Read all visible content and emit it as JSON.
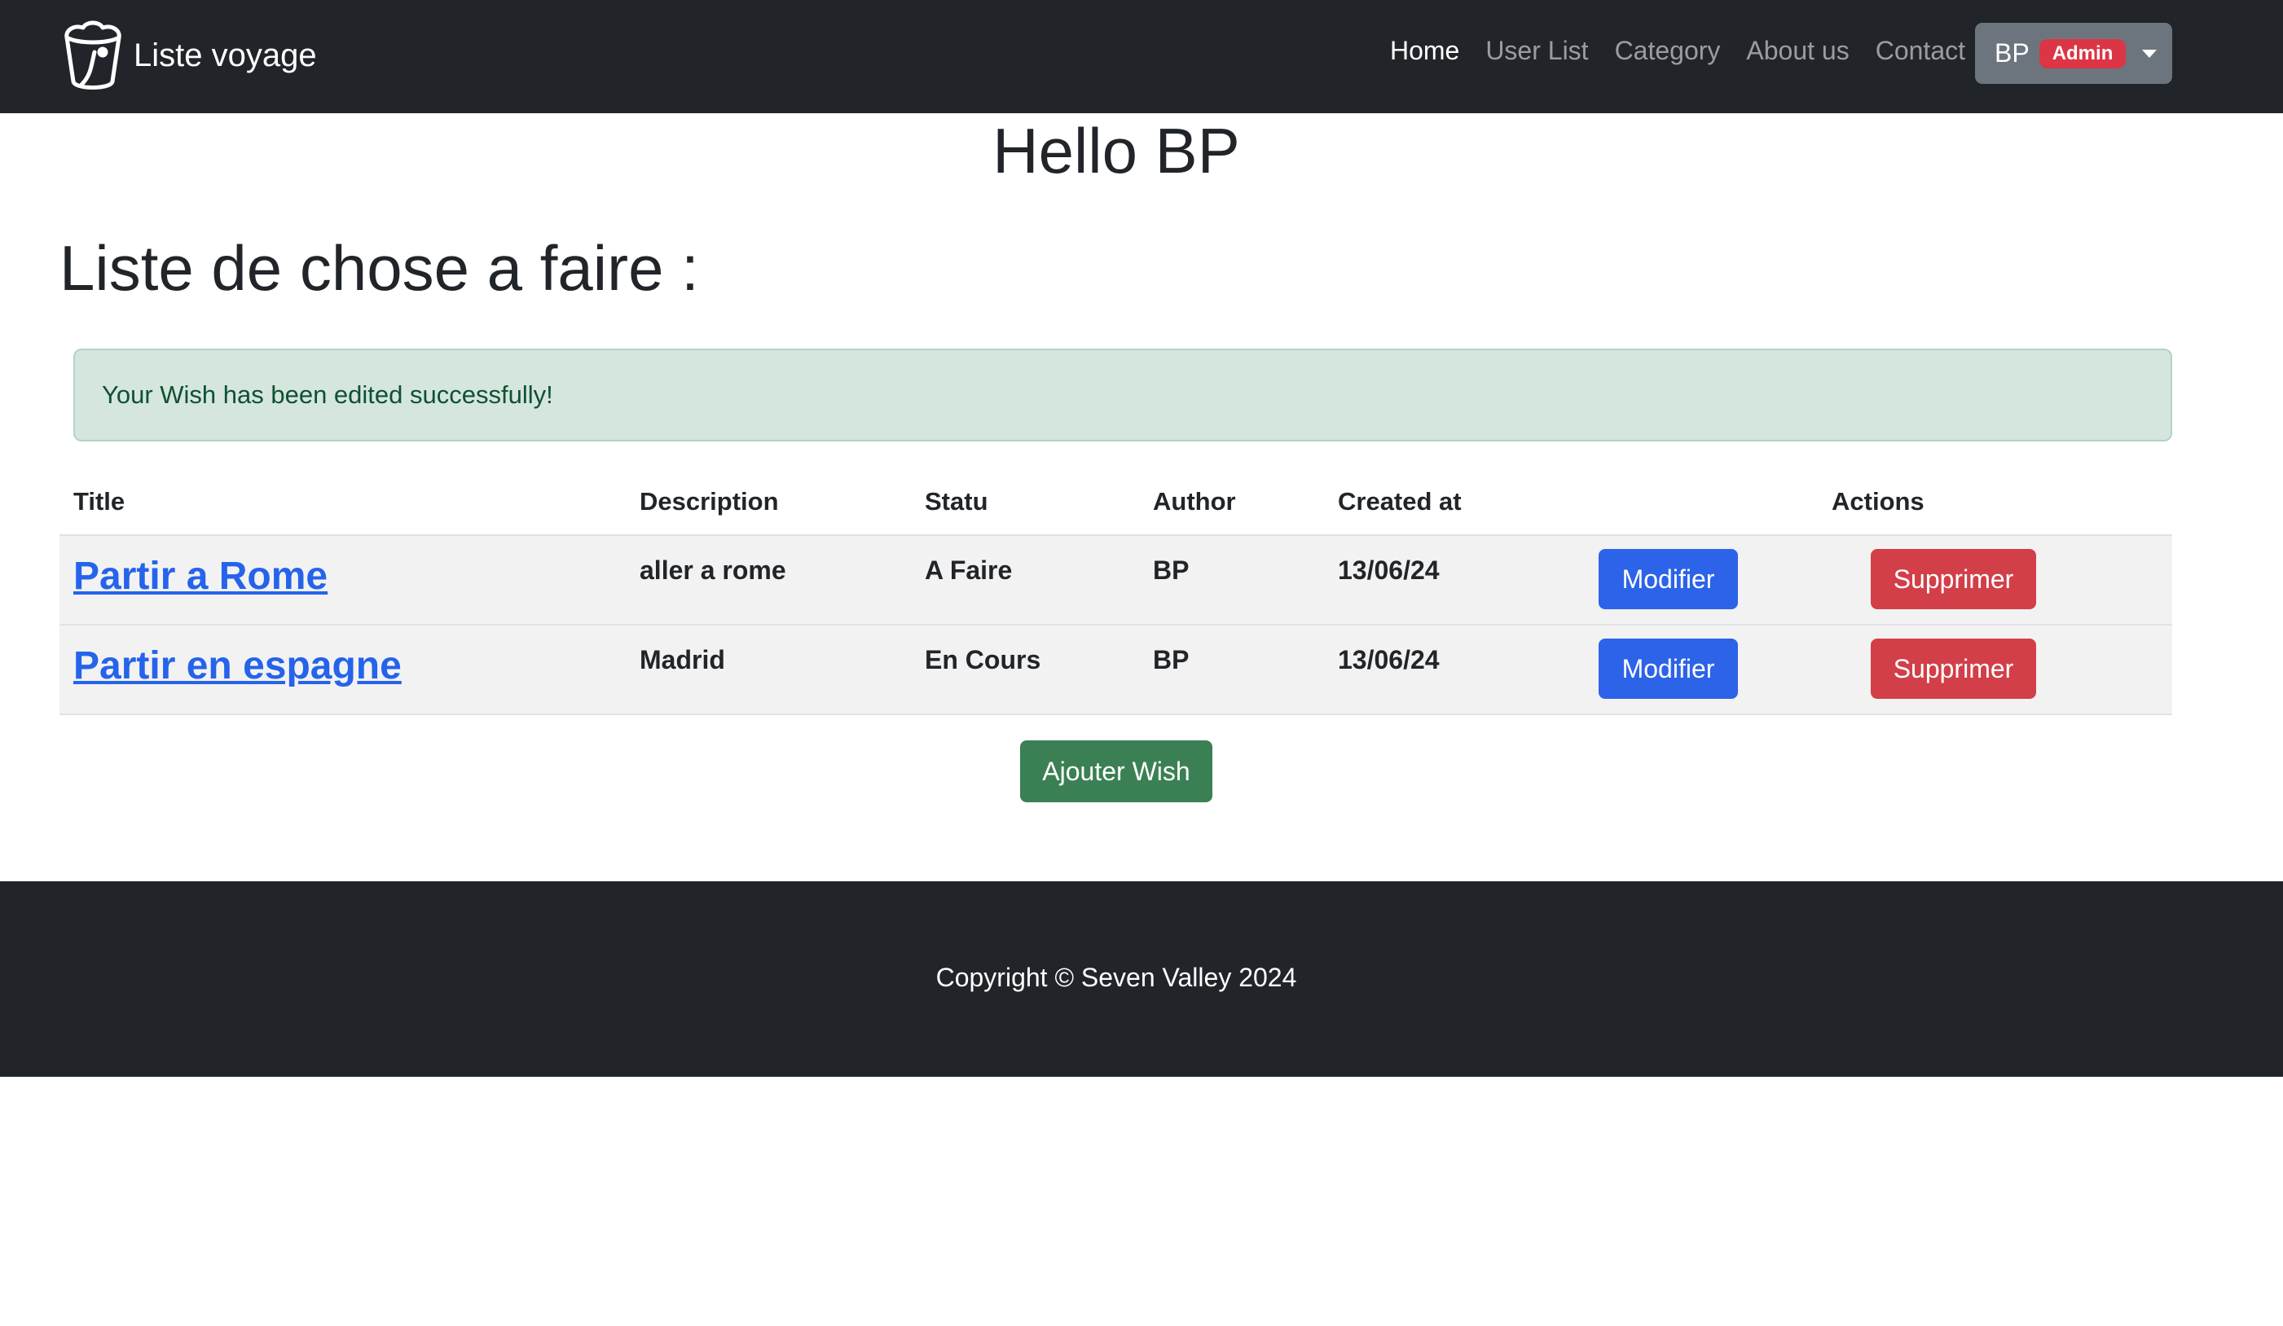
{
  "navbar": {
    "brand": "Liste voyage",
    "brand_icon": "shopping-bag-icon",
    "links": [
      "Home",
      "User List",
      "Category",
      "About us",
      "Contact"
    ],
    "active_link": "Home",
    "user": {
      "name": "BP",
      "role_badge": "Admin",
      "badge_color": "#dc3545"
    }
  },
  "main": {
    "greeting": "Hello BP",
    "heading": "Liste de chose a faire :",
    "alert": "Your Wish has been edited successfully!",
    "table": {
      "headers": {
        "title": "Title",
        "description": "Description",
        "status": "Statu",
        "author": "Author",
        "created": "Created at",
        "actions": "Actions"
      },
      "rows": [
        {
          "title": "Partir a Rome",
          "description": "aller a rome",
          "status": "A Faire",
          "author": "BP",
          "created": "13/06/24",
          "edit_label": "Modifier",
          "delete_label": "Supprimer"
        },
        {
          "title": "Partir en espagne",
          "description": "Madrid",
          "status": "En Cours",
          "author": "BP",
          "created": "13/06/24",
          "edit_label": "Modifier",
          "delete_label": "Supprimer"
        }
      ]
    },
    "add_button": "Ajouter Wish"
  },
  "footer": {
    "copyright": "Copyright © Seven Valley 2024"
  },
  "colors": {
    "navbar_bg": "#212529",
    "primary": "#2c63e8",
    "danger": "#d23f48",
    "success": "#3b8054",
    "alert_bg": "#d5e6de",
    "link": "#2563eb"
  }
}
